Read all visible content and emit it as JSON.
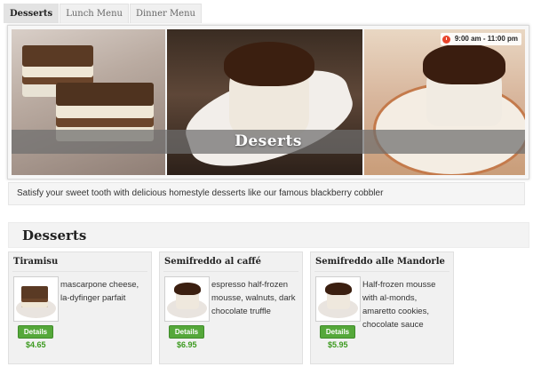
{
  "tabs": [
    {
      "label": "Desserts",
      "active": true
    },
    {
      "label": "Lunch Menu",
      "active": false
    },
    {
      "label": "Dinner Menu",
      "active": false
    }
  ],
  "banner": {
    "title": "Deserts",
    "hours": "9:00 am - 11:00 pm",
    "hours_icon": "clock-icon"
  },
  "description": "Satisfy your sweet tooth with delicious homestyle desserts like our famous blackberry cobbler",
  "section": {
    "title": "Desserts"
  },
  "items": [
    {
      "name": "Tiramisu",
      "description": "mascarpone cheese, la-dyfinger parfait",
      "button": "Details",
      "price": "$4.65"
    },
    {
      "name": "Semifreddo al caffé",
      "description": "espresso half-frozen mousse, walnuts, dark chocolate truffle",
      "button": "Details",
      "price": "$6.95"
    },
    {
      "name": "Semifreddo alle Mandorle",
      "description": "Half-frozen mousse with al-monds, amaretto cookies, chocolate sauce",
      "button": "Details",
      "price": "$5.95"
    }
  ],
  "colors": {
    "accent_green": "#55a83a",
    "price_green": "#3c9a1f",
    "clock_red": "#e8452c"
  }
}
